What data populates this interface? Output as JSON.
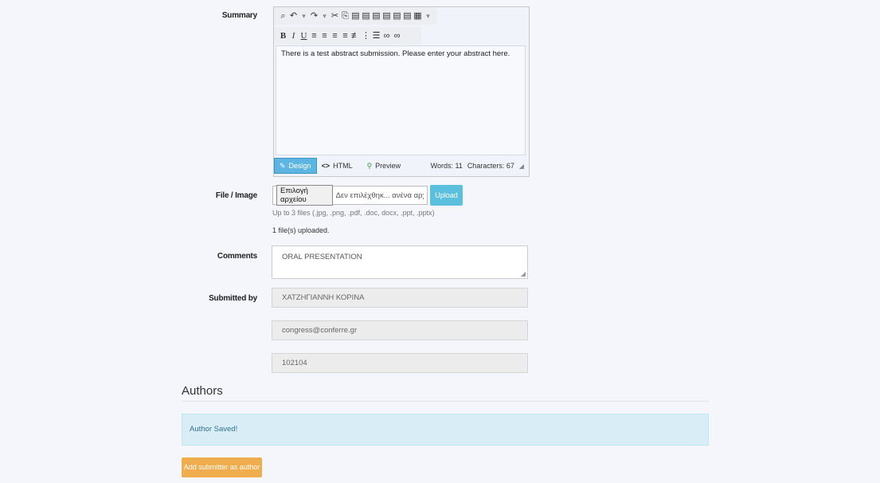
{
  "labels": {
    "summary": "Summary",
    "file": "File / Image",
    "comments": "Comments",
    "submitted_by": "Submitted by"
  },
  "editor": {
    "toolbar1_icons": [
      "binoculars-icon",
      "undo-icon",
      "dropdown-caret-icon",
      "redo-icon",
      "dropdown-caret-icon",
      "cut-icon",
      "copy-icon",
      "paste-icon",
      "paste-text-icon",
      "paste-word-icon",
      "paste-html-icon",
      "paste-clean-icon",
      "paste-format-icon",
      "table-icon",
      "dropdown-caret-icon"
    ],
    "bold": "B",
    "italic": "I",
    "underline": "U",
    "content": "There is a test abstract submission. Please enter your abstract here.",
    "modes": {
      "design": "Design",
      "html": "HTML",
      "preview": "Preview"
    },
    "words": "Words: 11",
    "characters": "Characters: 67"
  },
  "file": {
    "choose_button": "Επιλογή αρχείου",
    "status": "Δεν επιλέχθηκ... ανένα αρχείο.",
    "upload_button": "Upload",
    "hint": "Up to 3 files (.jpg, .png, .pdf, .doc, docx, .ppt, .pptx)",
    "uploaded": "1 file(s) uploaded."
  },
  "comments": {
    "value": "ORAL PRESENTATION"
  },
  "submitted_by": {
    "name": "ΧΑΤΖΗΓΙΑΝΝΗ ΚΟΡΙΝΑ",
    "email": "congress@conferre.gr",
    "id": "102104"
  },
  "authors": {
    "title": "Authors",
    "alert": "Author Saved!",
    "add_button": "Add submitter as author"
  },
  "colors": {
    "info_button": "#5bc0de",
    "warning_button": "#f0ad4e",
    "alert_bg": "#d9edf7",
    "alert_text": "#31708f"
  }
}
